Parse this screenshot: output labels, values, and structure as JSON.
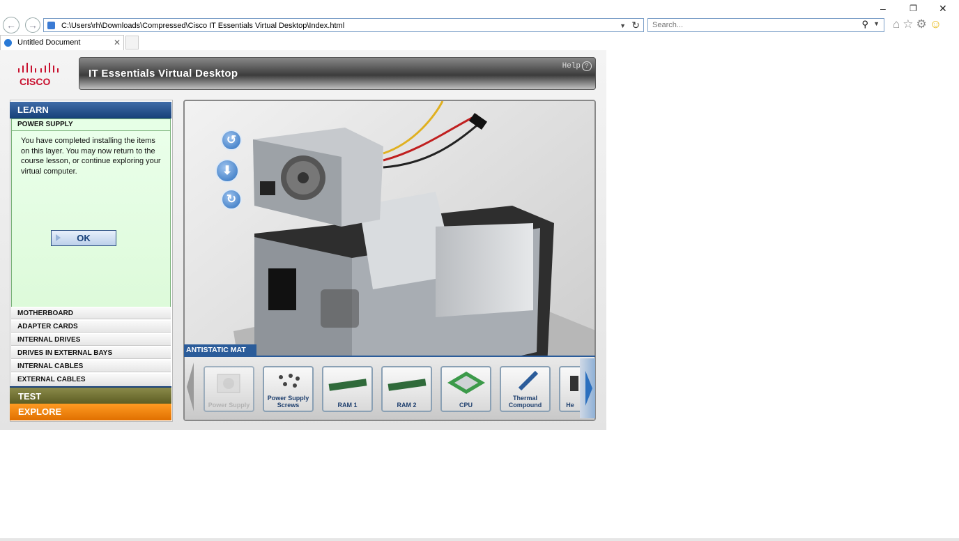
{
  "browser": {
    "address": "C:\\Users\\rh\\Downloads\\Compressed\\Cisco IT Essentials Virtual Desktop\\Index.html",
    "search_placeholder": "Search...",
    "tab_title": "Untitled Document",
    "window_controls": {
      "minimize": "–",
      "restore": "❐",
      "close": "✕"
    }
  },
  "app": {
    "logo_text": "CISCO",
    "title": "IT Essentials Virtual Desktop",
    "help_label": "Help",
    "learn_label": "LEARN",
    "current_section": "POWER SUPPLY",
    "message": "You have completed installing the items on this layer. You may now return to the course lesson, or continue exploring your virtual computer.",
    "ok_label": "OK",
    "categories": [
      "MOTHERBOARD",
      "ADAPTER CARDS",
      "INTERNAL DRIVES",
      "DRIVES IN EXTERNAL BAYS",
      "INTERNAL CABLES",
      "EXTERNAL CABLES"
    ],
    "test_label": "TEST",
    "explore_label": "EXPLORE",
    "mat_label": "ANTISTATIC MAT",
    "tray_items": [
      "Power Supply",
      "Power Supply Screws",
      "RAM 1",
      "RAM 2",
      "CPU",
      "Thermal Compound",
      "He"
    ],
    "controls": {
      "rotate_left": "rotate-ccw-icon",
      "down": "arrow-down-icon",
      "rotate_right": "rotate-cw-icon"
    }
  },
  "colors": {
    "learn_blue": "#163f78",
    "explore_orange": "#ff8a00",
    "test_olive": "#6e6e2f",
    "message_green": "#e6ffe6"
  }
}
